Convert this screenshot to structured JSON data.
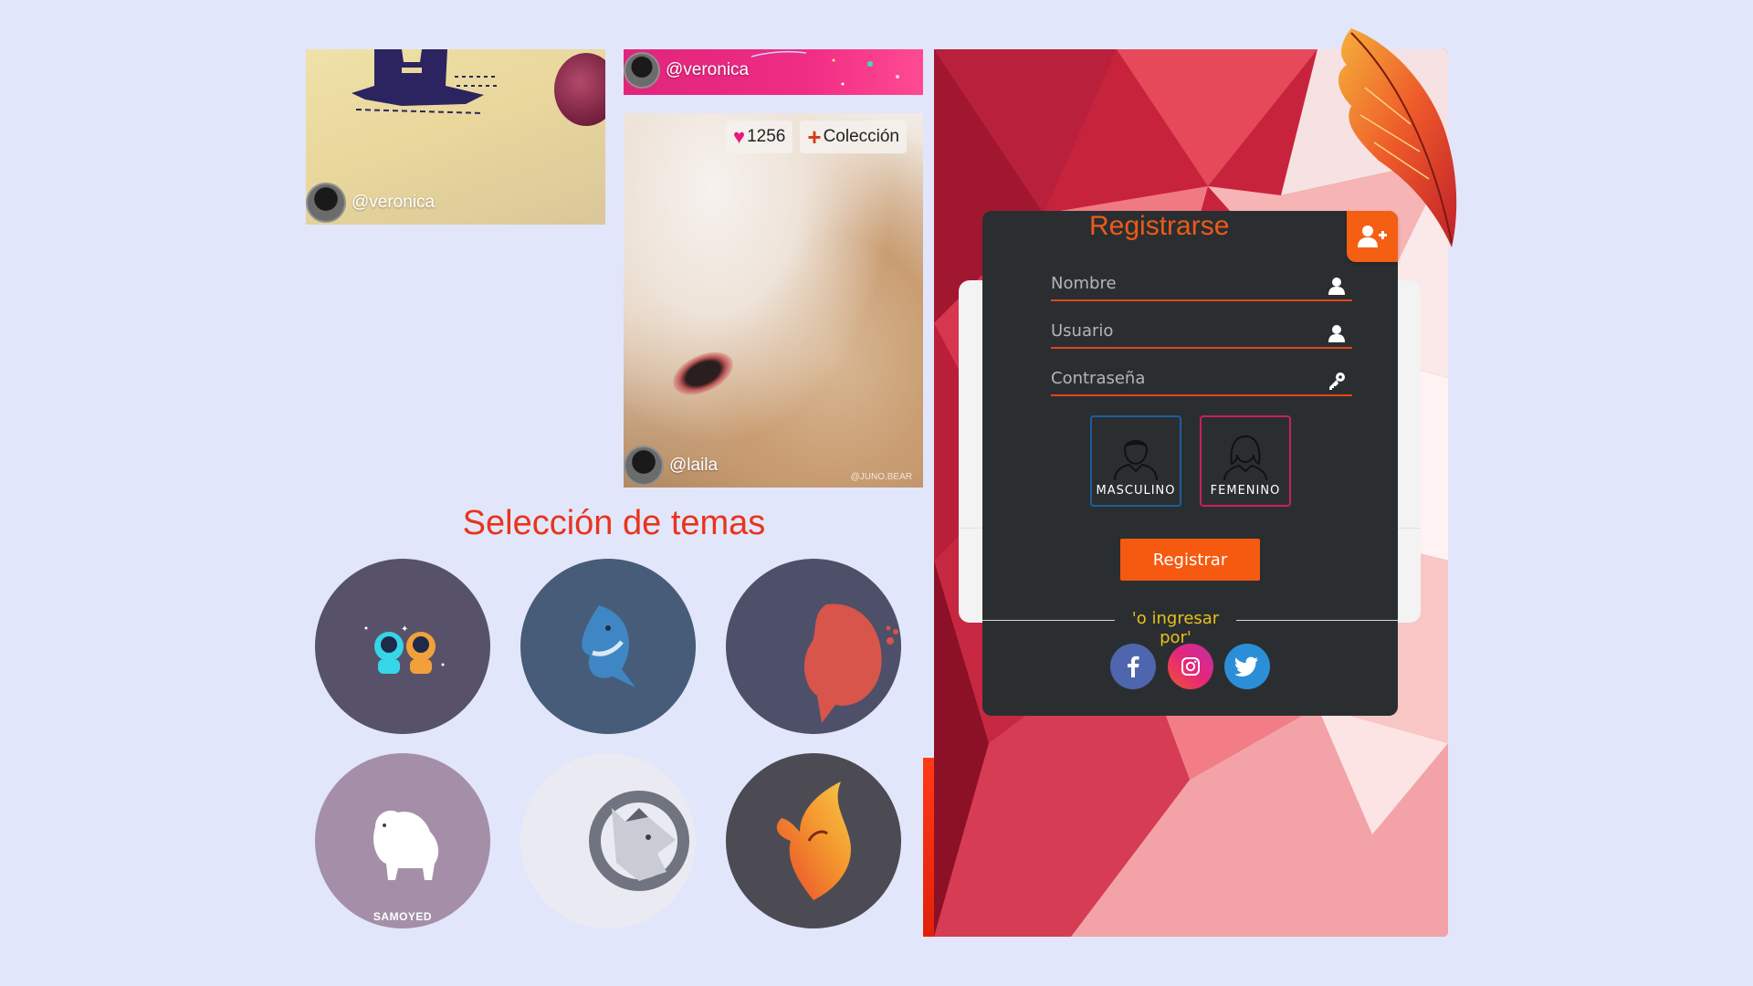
{
  "feed": {
    "cards": [
      {
        "user": "@veronica"
      },
      {
        "user": "@veronica"
      },
      {
        "user": "@laila",
        "likes": "1256",
        "collection_label": "Colección",
        "watermark": "@JUNO.BEAR"
      }
    ]
  },
  "themes": {
    "title": "Selección de temas",
    "items": [
      {
        "icon": "astronauts-icon",
        "caption": ""
      },
      {
        "icon": "shark-icon",
        "caption": ""
      },
      {
        "icon": "whale-icon",
        "caption": ""
      },
      {
        "icon": "samoyed-dog-icon",
        "caption": "SAMOYED"
      },
      {
        "icon": "wolf-icon",
        "caption": ""
      },
      {
        "icon": "phoenix-icon",
        "caption": ""
      }
    ]
  },
  "register": {
    "title": "Registrarse",
    "fields": {
      "name_placeholder": "Nombre",
      "user_placeholder": "Usuario",
      "password_placeholder": "Contraseña"
    },
    "gender": {
      "male_label": "MASCULINO",
      "female_label": "FEMENINO"
    },
    "submit_label": "Registrar",
    "or_label": "'o ingresar por'",
    "social": [
      "facebook-icon",
      "instagram-icon",
      "twitter-icon"
    ]
  },
  "colors": {
    "accent": "#f55a10",
    "title_red": "#e8341c",
    "panel_dark": "#2b2e31",
    "male_border": "#1d5f9c",
    "female_border": "#c8205e",
    "or_text": "#e8c11a"
  }
}
